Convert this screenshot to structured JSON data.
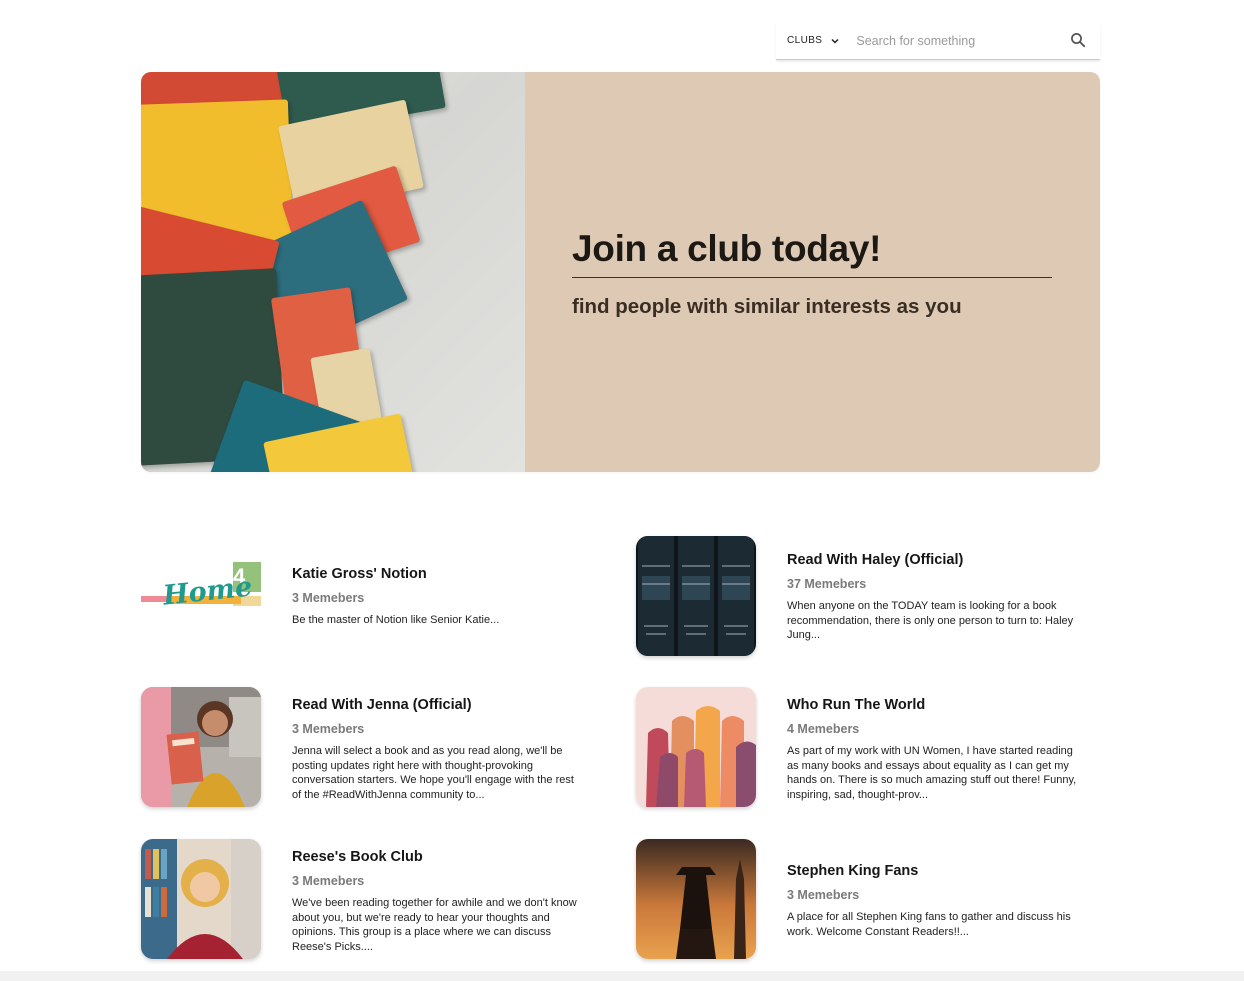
{
  "search": {
    "filter_label": "CLUBS",
    "placeholder": "Search for something",
    "filter_icon": "chevron-down-icon",
    "search_icon": "search-icon"
  },
  "hero": {
    "title": "Join a club today!",
    "subtitle": "find people with similar interests as you",
    "background_color": "#decab4"
  },
  "clubs": [
    {
      "name": "Katie Gross' Notion",
      "members": "3 Memebers",
      "description": "Be the master of Notion like Senior Katie..."
    },
    {
      "name": "Read With Haley (Official)",
      "members": "37 Memebers",
      "description": "When anyone on the TODAY team is looking for a book recommendation, there is only one person to turn to: Haley Jung..."
    },
    {
      "name": "Read With Jenna (Official)",
      "members": "3 Memebers",
      "description": "Jenna will select a book and as you read along, we'll be posting updates right here with thought-provoking conversation starters. We hope you'll engage with the rest of the #ReadWithJenna community to..."
    },
    {
      "name": "Who Run The World",
      "members": "4 Memebers",
      "description": "As part of my work with UN Women, I have started reading as many books and essays about equality as I can get my hands on. There is so much amazing stuff out there! Funny, inspiring, sad, thought-prov..."
    },
    {
      "name": "Reese's Book Club",
      "members": "3 Memebers",
      "description": "We've been reading together for awhile and we don't know about you, but we're ready to hear your thoughts and opinions. This group is a place where we can discuss Reese's Picks...."
    },
    {
      "name": "Stephen King Fans",
      "members": "3 Memebers",
      "description": "A place for all Stephen King fans to gather and discuss his work. Welcome Constant Readers!!..."
    }
  ],
  "thumbnails": {
    "katie_logo_text": "Home"
  }
}
